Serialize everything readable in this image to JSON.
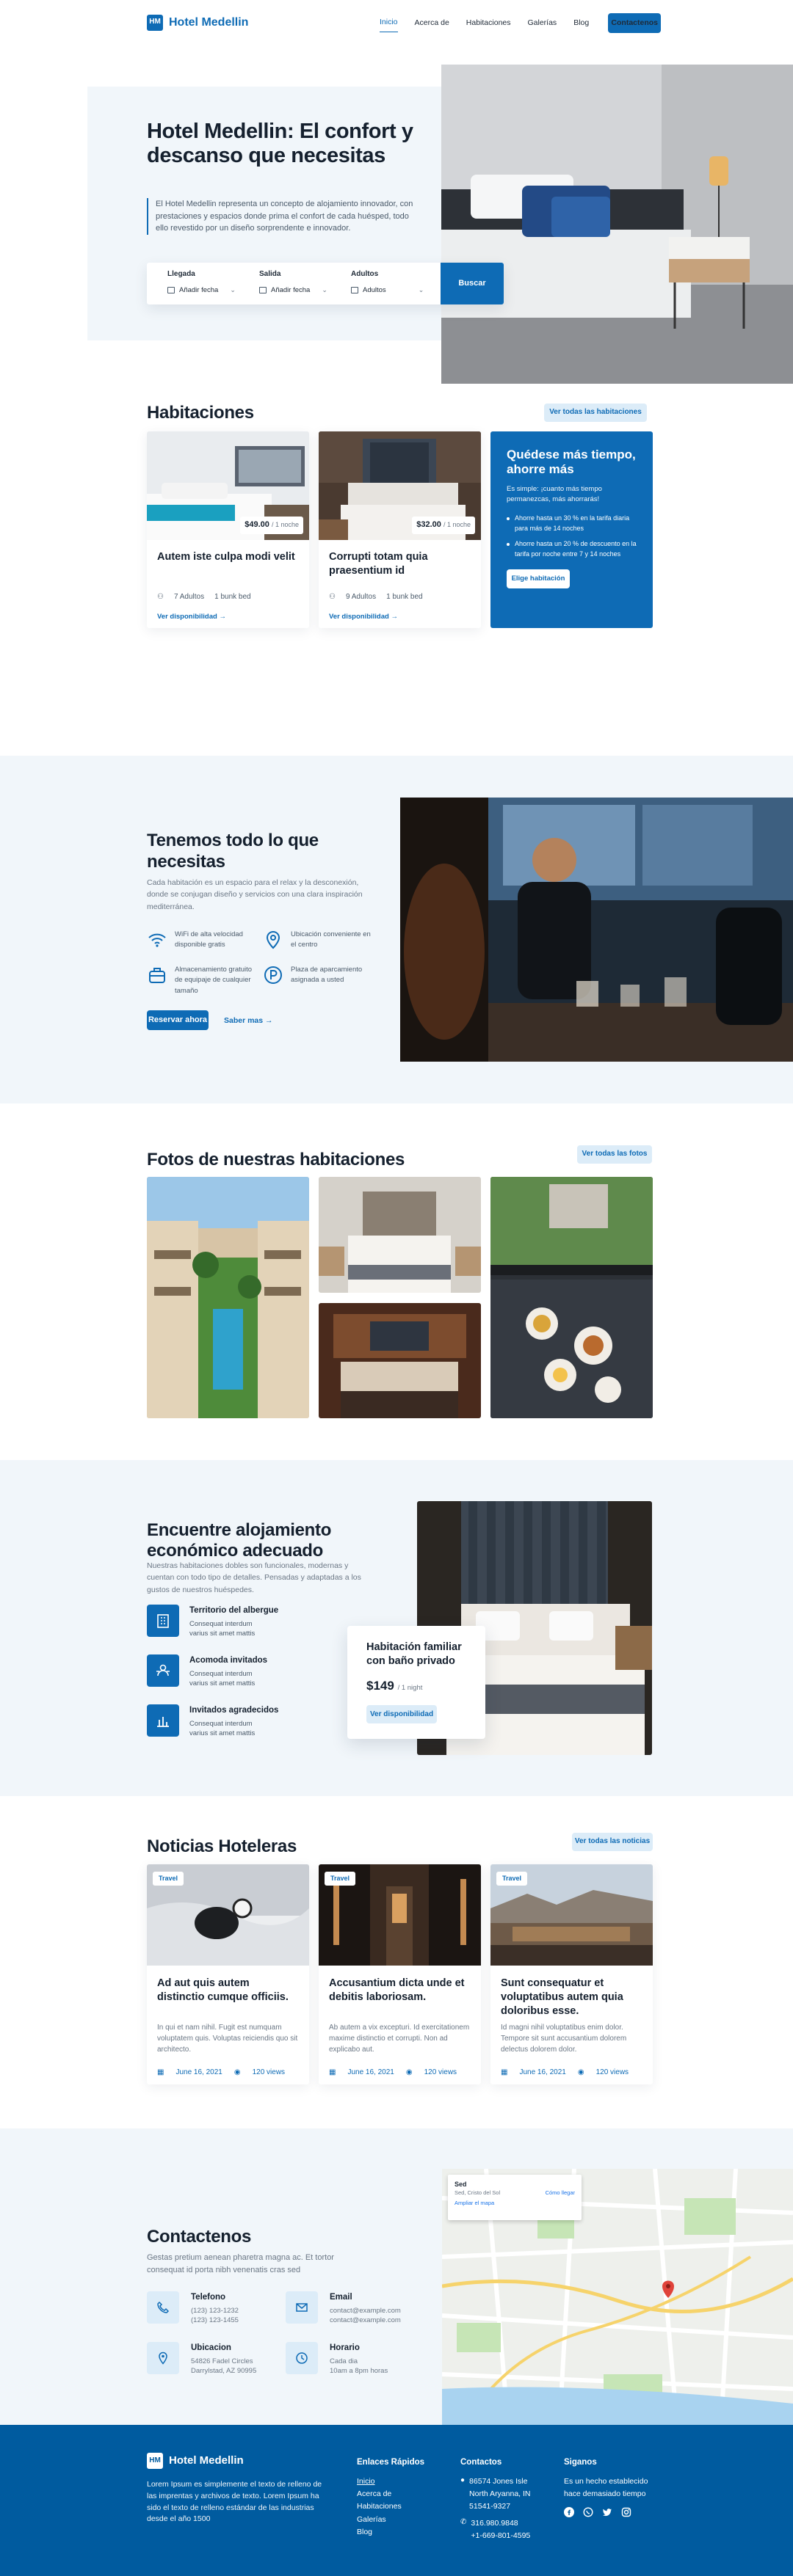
{
  "brand": {
    "name": "Hotel Medellin",
    "mark": "HM"
  },
  "nav": {
    "items": [
      "Inicio",
      "Acerca de",
      "Habitaciones",
      "Galerías",
      "Blog"
    ],
    "cta": "Contactenos"
  },
  "hero": {
    "title": "Hotel Medellin: El confort y descanso que necesitas",
    "lead": "El Hotel Medellin representa un concepto de alojamiento innovador, con prestaciones y espacios donde prima el confort de cada huésped, todo ello revestido por un diseño sorprendente e innovador.",
    "booking": {
      "checkin_label": "Llegada",
      "checkin_value": "Añadir fecha",
      "checkout_label": "Salida",
      "checkout_value": "Añadir fecha",
      "adults_label": "Adultos",
      "adults_value": "Adultos",
      "search": "Buscar"
    }
  },
  "rooms": {
    "title": "Habitaciones",
    "see_all": "Ver todas las habitaciones",
    "cards": [
      {
        "price": "$49.00",
        "per": "/ 1 noche",
        "title": "Autem iste culpa modi velit",
        "guests": "7 Adultos",
        "bed": "1 bunk bed",
        "link": "Ver disponibilidad →"
      },
      {
        "price": "$32.00",
        "per": "/ 1 noche",
        "title": "Corrupti totam quia praesentium id",
        "guests": "9 Adultos",
        "bed": "1 bunk bed",
        "link": "Ver disponibilidad →"
      }
    ],
    "promo": {
      "title": "Quédese más tiempo, ahorre más",
      "text": "Es simple: ¡cuanto más tiempo permanezcas, más ahorrarás!",
      "bullets": [
        "Ahorre hasta un 30 % en la tarifa diaria para más de 14 noches",
        "Ahorre hasta un 20 % de descuento en la tarifa por noche entre 7 y 14 noches"
      ],
      "button": "Elige habitación"
    }
  },
  "amenities": {
    "title": "Tenemos todo lo que necesitas",
    "text": "Cada habitación es un espacio para el relax y la desconexión, donde se conjugan diseño y servicios con una clara inspiración mediterránea.",
    "features": [
      "WiFi de alta velocidad disponible gratis",
      "Ubicación conveniente en el centro",
      "Almacenamiento gratuito de equipaje de cualquier tamaño",
      "Plaza de aparcamiento asignada a usted"
    ],
    "primary": "Reservar ahora",
    "secondary": "Saber mas →"
  },
  "gallery": {
    "title": "Fotos de nuestras habitaciones",
    "see_all": "Ver todas las fotos"
  },
  "finder": {
    "title": "Encuentre alojamiento económico adecuado",
    "text": "Nuestras habitaciones dobles son funcionales, modernas y cuentan con todo tipo de detalles. Pensadas y adaptadas a los gustos de nuestros huéspedes.",
    "items": [
      {
        "title": "Territorio del albergue",
        "text": "Consequat interdum varius sit amet mattis"
      },
      {
        "title": "Acomoda invitados",
        "text": "Consequat interdum varius sit amet mattis"
      },
      {
        "title": "Invitados agradecidos",
        "text": "Consequat interdum varius sit amet mattis"
      }
    ],
    "card": {
      "title": "Habitación familiar con baño privado",
      "price": "$149",
      "per": "/ 1 night",
      "button": "Ver disponibilidad"
    }
  },
  "news": {
    "title": "Noticias Hoteleras",
    "see_all": "Ver todas las noticias",
    "cards": [
      {
        "tag": "Travel",
        "title": "Ad aut quis autem distinctio cumque officiis.",
        "excerpt": "In qui et nam nihil. Fugit est numquam voluptatem quis. Voluptas reiciendis quo sit architecto.",
        "date": "June 16, 2021",
        "views": "120 views"
      },
      {
        "tag": "Travel",
        "title": "Accusantium dicta unde et debitis laboriosam.",
        "excerpt": "Ab autem a vix excepturi. Id exercitationem maxime distinctio et corrupti. Non ad explicabo aut.",
        "date": "June 16, 2021",
        "views": "120 views"
      },
      {
        "tag": "Travel",
        "title": "Sunt consequatur et voluptatibus autem quia doloribus esse.",
        "excerpt": "Id magni nihil voluptatibus enim dolor. Tempore sit sunt accusantium dolorem delectus dolorem dolor.",
        "date": "June 16, 2021",
        "views": "120 views"
      }
    ]
  },
  "contact": {
    "title": "Contactenos",
    "text": "Gestas pretium aenean pharetra magna ac. Et tortor consequat id porta nibh venenatis cras sed",
    "phone": {
      "label": "Telefono",
      "lines": [
        "(123) 123-1232",
        "(123) 123-1455"
      ]
    },
    "email": {
      "label": "Email",
      "lines": [
        "contact@example.com",
        "contact@example.com"
      ]
    },
    "location": {
      "label": "Ubicacion",
      "lines": [
        "54826 Fadel Circles",
        "Darrylstad, AZ 90995"
      ]
    },
    "hours": {
      "label": "Horario",
      "lines": [
        "Cada dia",
        "10am a 8pm horas"
      ]
    },
    "map": {
      "place": "Sed",
      "address": "Sed, Cristo del Sol",
      "enlarge": "Ampliar el mapa",
      "directions": "Cómo llegar"
    }
  },
  "footer": {
    "name": "Hotel Medellin",
    "text": "Lorem Ipsum es simplemente el texto de relleno de las imprentas y archivos de texto. Lorem Ipsum ha sido el texto de relleno estándar de las industrias desde el año 1500",
    "links_title": "Enlaces Rápidos",
    "links": [
      "Inicio",
      "Acerca de",
      "Habitaciones",
      "Galerías",
      "Blog"
    ],
    "contact_title": "Contactos",
    "address": "86574 Jones Isle North Aryanna, IN 51541-9327",
    "phones": [
      "316.980.9848",
      "+1-669-801-4595"
    ],
    "follow_title": "Siganos",
    "follow_text": "Es un hecho establecido hace demasiado tiempo"
  },
  "colors": {
    "accent": "#0e6bb5",
    "footer": "#005b9f",
    "soft": "#f1f6fa",
    "pill": "#dcecf8"
  }
}
